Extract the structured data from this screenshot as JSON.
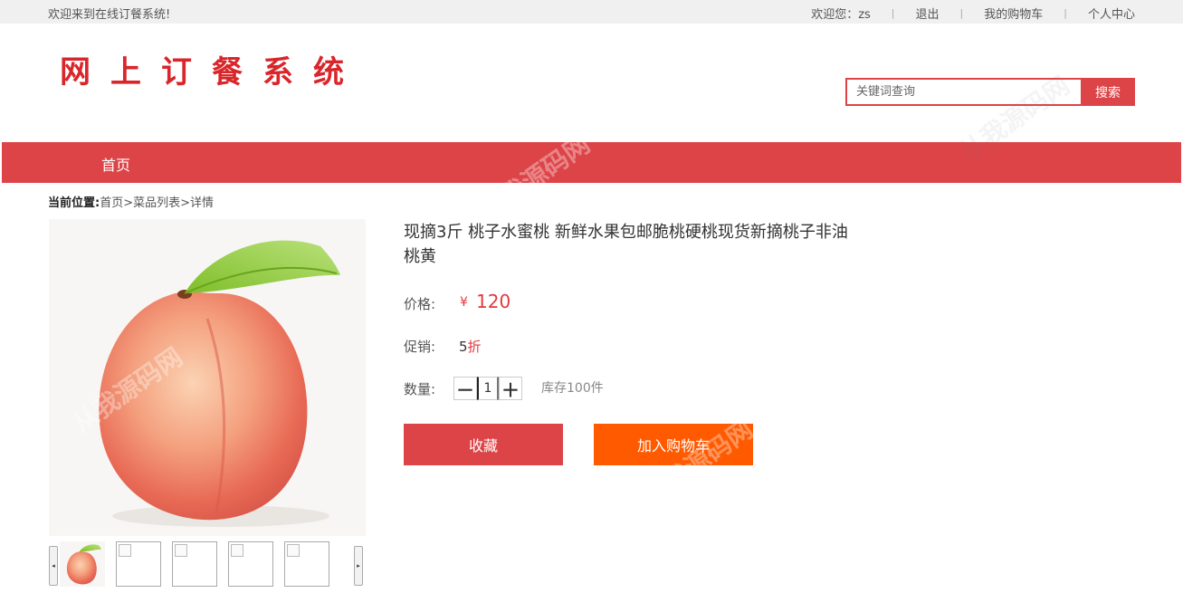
{
  "topbar": {
    "welcome": "欢迎来到在线订餐系统!",
    "user_greeting": "欢迎您：zs",
    "logout": "退出",
    "cart": "我的购物车",
    "profile": "个人中心",
    "separator": "|"
  },
  "header": {
    "logo_text": "网上订餐系统",
    "search_placeholder": "关键词查询",
    "search_button": "搜索"
  },
  "nav": {
    "home": "首页"
  },
  "breadcrumb": {
    "lead": "当前位置:",
    "home": "首页",
    "list": "菜品列表",
    "current": "详情",
    "sep": ">"
  },
  "product": {
    "title": "现摘3斤 桃子水蜜桃 新鲜水果包邮脆桃硬桃现货新摘桃子非油桃黄",
    "price_label": "价格:",
    "currency": "¥",
    "price": "120",
    "promo_label": "促销:",
    "promo_num": "5",
    "promo_unit": "折",
    "qty_label": "数量:",
    "qty_value": "1",
    "qty_minus": "－",
    "qty_plus": "＋",
    "stock": "库存100件",
    "fav_button": "收藏",
    "cart_button": "加入购物车"
  },
  "gallery": {
    "prev": "◂",
    "next": "▸",
    "image_subject": "peach-with-leaf"
  },
  "watermark": "从我源码网",
  "colors": {
    "brand_red": "#dd4448",
    "cart_orange": "#ff5a00",
    "price_red": "#e4393c",
    "topbar_bg": "#f0f0f0"
  }
}
